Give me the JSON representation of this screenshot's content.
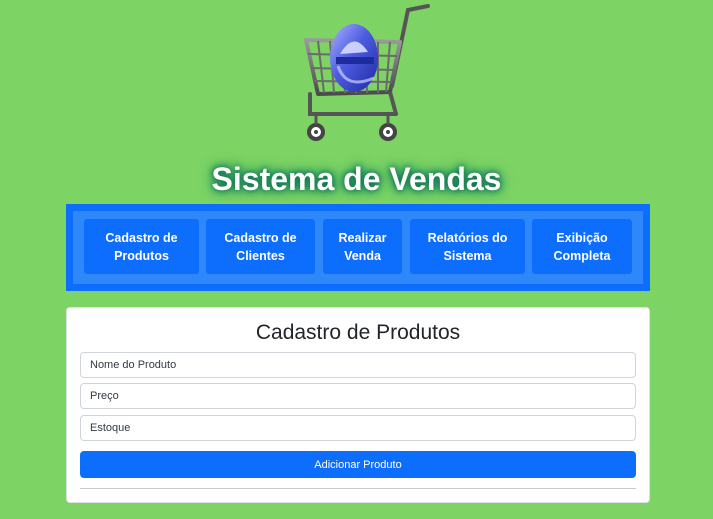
{
  "header": {
    "logo_icon": "e-commerce-shopping-cart-logo",
    "title": "Sistema de Vendas"
  },
  "nav": {
    "items": [
      {
        "label": "Cadastro de\nProdutos"
      },
      {
        "label": "Cadastro de\nClientes"
      },
      {
        "label": "Realizar\nVenda"
      },
      {
        "label": "Relatórios do\nSistema"
      },
      {
        "label": "Exibição\nCompleta"
      }
    ]
  },
  "form": {
    "title": "Cadastro de Produtos",
    "name_placeholder": "Nome do Produto",
    "price_placeholder": "Preço",
    "stock_placeholder": "Estoque",
    "submit_label": "Adicionar Produto"
  },
  "colors": {
    "background": "#7dd364",
    "primary": "#0d6efd",
    "nav_frame": "#2e88fa"
  }
}
